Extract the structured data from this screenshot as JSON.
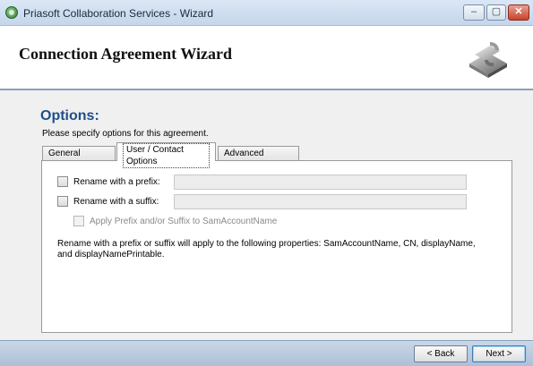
{
  "window": {
    "title": "Priasoft Collaboration Services - Wizard",
    "controls": {
      "minimize": "–",
      "maximize": "▢",
      "close": "✕"
    }
  },
  "header": {
    "title": "Connection Agreement Wizard",
    "logo_icon": "priasoft-logo-icon"
  },
  "page": {
    "title": "Options",
    "title_suffix": ":",
    "description": "Please specify options for this agreement."
  },
  "tabs": [
    {
      "label": "General Options",
      "selected": false
    },
    {
      "label": "User / Contact Options",
      "selected": true
    },
    {
      "label": "Advanced Options",
      "selected": false
    }
  ],
  "options": {
    "prefix": {
      "label": "Rename with a prefix:",
      "checked": false,
      "value": ""
    },
    "suffix": {
      "label": "Rename with a suffix:",
      "checked": false,
      "value": ""
    },
    "apply_sam": {
      "label": "Apply Prefix and/or Suffix to SamAccountName",
      "checked": false,
      "enabled": false
    }
  },
  "note": "Rename with a prefix or suffix will apply to the following properties: SamAccountName, CN, displayName, and displayNamePrintable.",
  "footer": {
    "back_label": "< Back",
    "next_label": "Next >"
  },
  "colors": {
    "accent_title": "#1f4e8a",
    "close_button": "#c7442c"
  }
}
